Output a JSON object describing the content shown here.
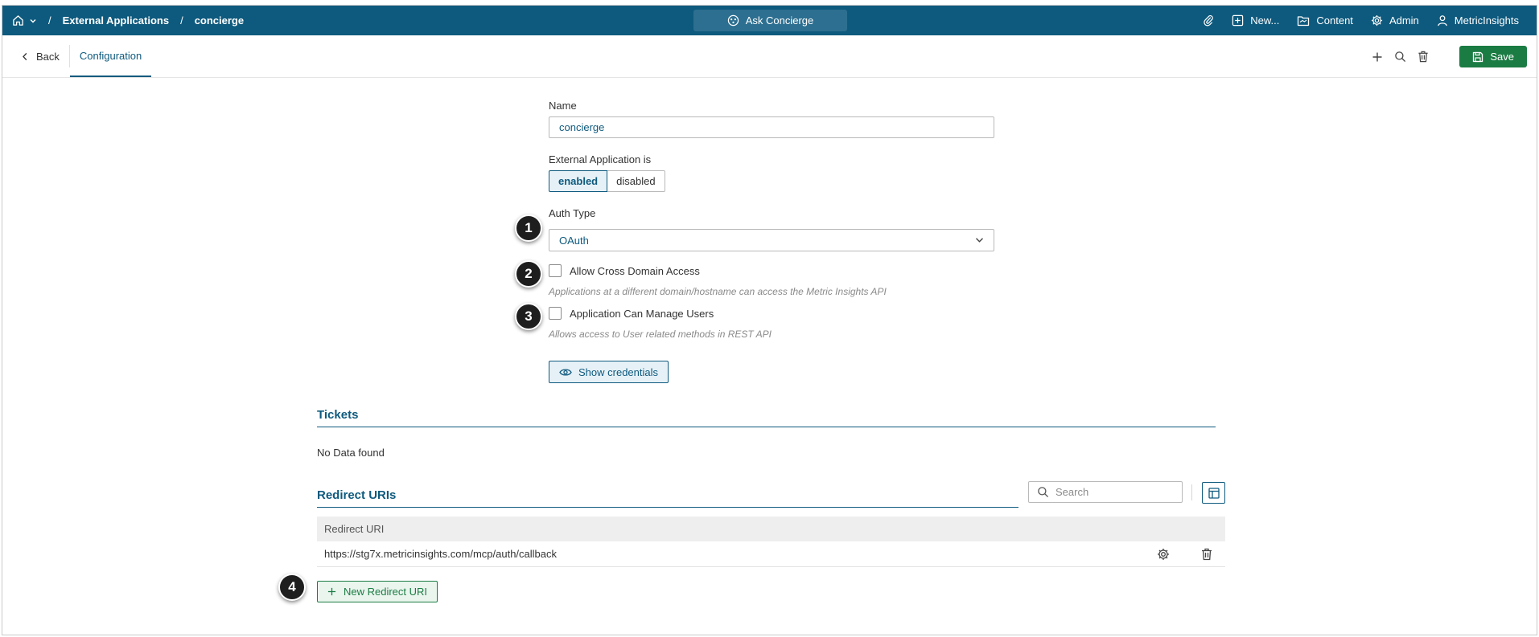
{
  "topbar": {
    "breadcrumb": [
      "External Applications",
      "concierge"
    ],
    "separator": "/",
    "ask_label": "Ask Concierge",
    "items": [
      {
        "label": "New...",
        "icon": "plus-square-icon"
      },
      {
        "label": "Content",
        "icon": "folder-icon"
      },
      {
        "label": "Admin",
        "icon": "gear-icon"
      },
      {
        "label": "MetricInsights",
        "icon": "user-icon"
      }
    ]
  },
  "subbar": {
    "back_label": "Back",
    "tab_label": "Configuration",
    "save_label": "Save"
  },
  "form": {
    "name_label": "Name",
    "name_value": "concierge",
    "status_label": "External Application is",
    "status_options": [
      "enabled",
      "disabled"
    ],
    "status_selected": "enabled",
    "auth_label": "Auth Type",
    "auth_value": "OAuth",
    "cross_domain_label": "Allow Cross Domain Access",
    "cross_domain_hint": "Applications at a different domain/hostname can access the Metric Insights API",
    "cross_domain_checked": false,
    "manage_users_label": "Application Can Manage Users",
    "manage_users_hint": "Allows access to User related methods in REST API",
    "manage_users_checked": false,
    "credentials_button": "Show credentials"
  },
  "callouts": [
    "1",
    "2",
    "3",
    "4"
  ],
  "tickets": {
    "title": "Tickets",
    "empty_text": "No Data found"
  },
  "redirect": {
    "title": "Redirect URIs",
    "search_placeholder": "Search",
    "column_header": "Redirect URI",
    "rows": [
      "https://stg7x.metricinsights.com/mcp/auth/callback"
    ],
    "new_button": "New Redirect URI"
  },
  "colors": {
    "brand": "#0e5a7e",
    "save": "#1b7c43"
  }
}
